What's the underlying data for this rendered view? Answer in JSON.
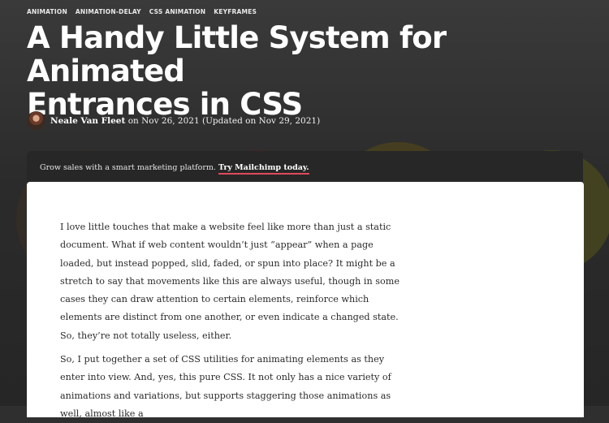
{
  "tags": [
    "ANIMATION",
    "ANIMATION-DELAY",
    "CSS ANIMATION",
    "KEYFRAMES"
  ],
  "title_line1": "A Handy Little System for Animated",
  "title_line2": "Entrances in CSS",
  "byline": {
    "author": "Neale Van Fleet",
    "date_text": "on Nov 26, 2021 (Updated on Nov 29, 2021)"
  },
  "promo": {
    "text": "Grow sales with a smart marketing platform.",
    "link": "Try Mailchimp today.",
    "link_underline_color": "#e0495a"
  },
  "article": {
    "paragraph1": "I love little touches that make a website feel like more than just a static document. What if web content wouldn’t just “appear” when a page loaded, but instead popped, slid, faded, or spun into place? It might be a stretch to say that movements like this are always useful, though in some cases they can draw attention to certain elements, reinforce which elements are distinct from one another, or even indicate a changed state. So, they’re not totally useless, either.",
    "paragraph2": "So, I put together a set of CSS utilities for animating elements as they enter into view. And, yes, this pure CSS. It not only has a nice variety of animations and variations, but supports staggering those animations as well, almost like a"
  }
}
